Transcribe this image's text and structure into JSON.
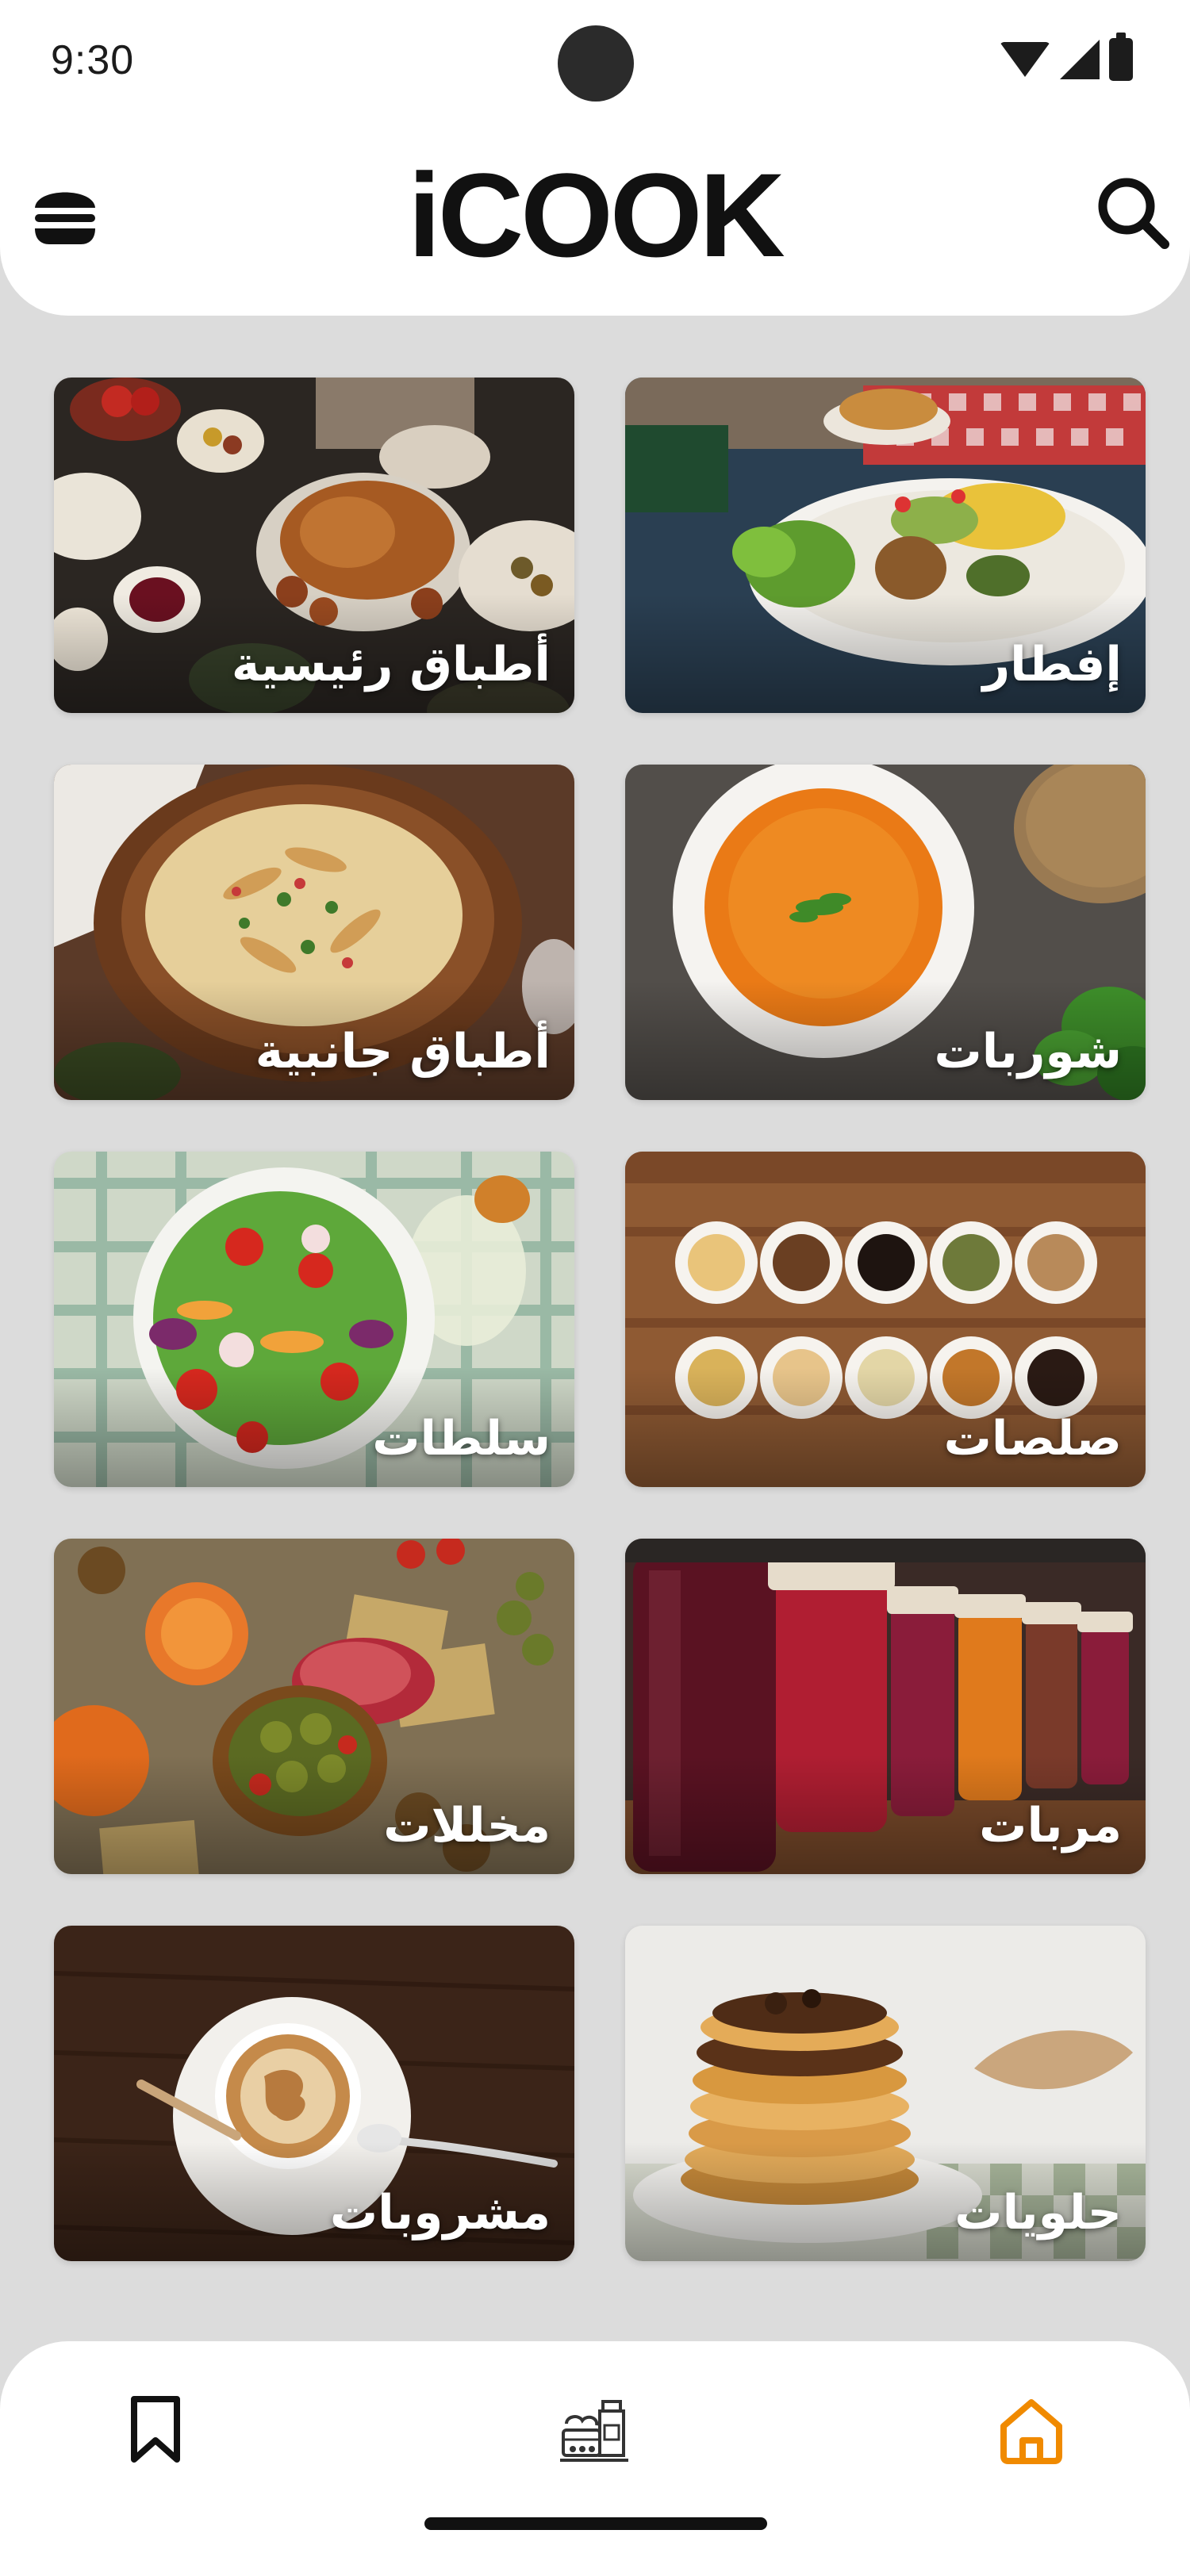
{
  "status_bar": {
    "time": "9:30"
  },
  "header": {
    "app_title": "iCOOK",
    "menu_icon": "hamburger-icon",
    "search_icon": "search-icon"
  },
  "categories": [
    {
      "label": "إفطار"
    },
    {
      "label": "أطباق رئيسية"
    },
    {
      "label": "شوربات"
    },
    {
      "label": "أطباق جانبية"
    },
    {
      "label": "صلصات"
    },
    {
      "label": "سلطات"
    },
    {
      "label": "مربات"
    },
    {
      "label": "مخللات"
    },
    {
      "label": "حلويات"
    },
    {
      "label": "مشروبات"
    }
  ],
  "bottom_nav": {
    "items": [
      {
        "icon": "bookmark-icon",
        "active": false
      },
      {
        "icon": "pantry-icon",
        "active": false
      },
      {
        "icon": "home-icon",
        "active": true
      }
    ],
    "active_color": "#f08a00"
  }
}
